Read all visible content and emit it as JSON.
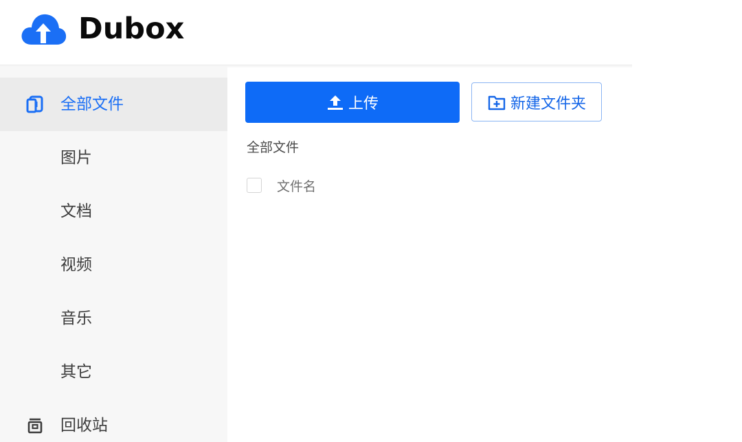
{
  "header": {
    "logo_text": "Dubox",
    "brand_color": "#1b6ff5"
  },
  "sidebar": {
    "items": [
      {
        "label": "全部文件",
        "icon": "all-files-icon",
        "active": true
      },
      {
        "label": "图片",
        "icon": null,
        "active": false
      },
      {
        "label": "文档",
        "icon": null,
        "active": false
      },
      {
        "label": "视频",
        "icon": null,
        "active": false
      },
      {
        "label": "音乐",
        "icon": null,
        "active": false
      },
      {
        "label": "其它",
        "icon": null,
        "active": false
      },
      {
        "label": "回收站",
        "icon": "trash-icon",
        "active": false
      }
    ]
  },
  "toolbar": {
    "upload_label": "上传",
    "new_folder_label": "新建文件夹"
  },
  "main": {
    "breadcrumb": "全部文件",
    "columns": {
      "name": "文件名"
    }
  },
  "colors": {
    "accent": "#0e6bf7",
    "active_text": "#1b6ff5",
    "sidebar_bg": "#f7f7f7",
    "sidebar_active_bg": "#ebebeb"
  }
}
